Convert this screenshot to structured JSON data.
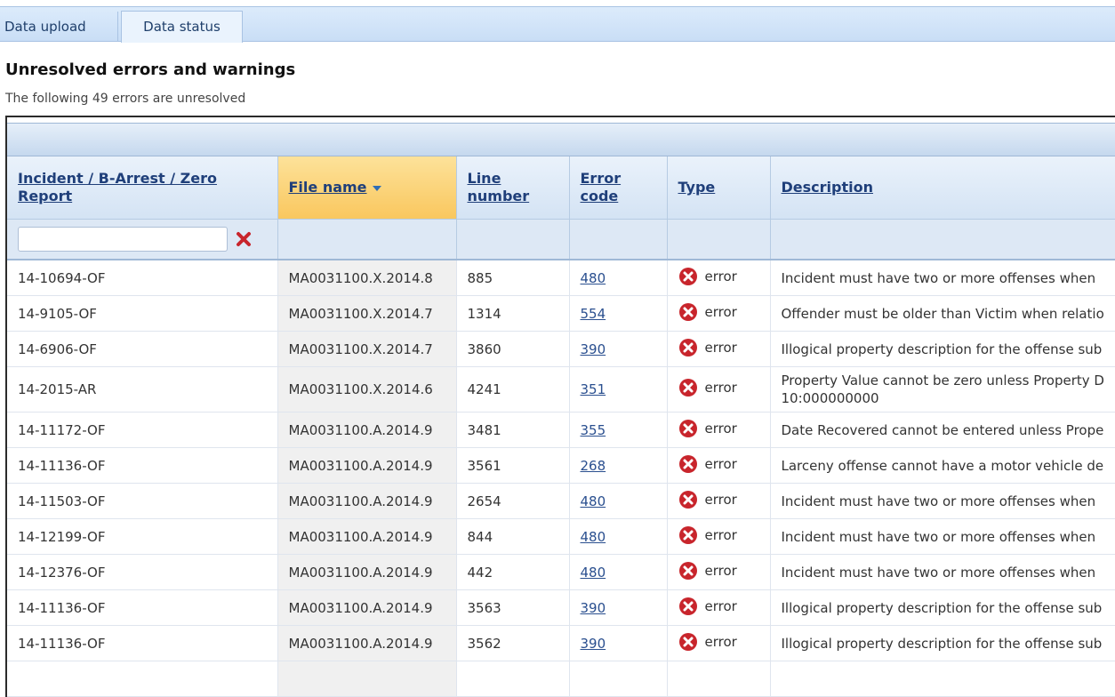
{
  "tabs": [
    {
      "label": "Data upload",
      "active": false
    },
    {
      "label": "Data status",
      "active": true
    }
  ],
  "page": {
    "title": "Unresolved errors and warnings",
    "subtitle": "The following 49 errors are unresolved"
  },
  "table": {
    "columns": [
      "Incident / B-Arrest / Zero Report",
      "File name",
      "Line number",
      "Error code",
      "Type",
      "Description"
    ],
    "sorted_column": "File name",
    "sort_direction": "descending",
    "filter": {
      "value": "",
      "clear_icon": "red-x-icon"
    },
    "rows": [
      {
        "incident": "14-10694-OF",
        "file": "MA0031100.X.2014.8",
        "line": "885",
        "code": "480",
        "type": "error",
        "description": "Incident must have two or more offenses when"
      },
      {
        "incident": "14-9105-OF",
        "file": "MA0031100.X.2014.7",
        "line": "1314",
        "code": "554",
        "type": "error",
        "description": "Offender must be older than Victim when relatio"
      },
      {
        "incident": "14-6906-OF",
        "file": "MA0031100.X.2014.7",
        "line": "3860",
        "code": "390",
        "type": "error",
        "description": "Illogical property description for the offense sub"
      },
      {
        "incident": "14-2015-AR",
        "file": "MA0031100.X.2014.6",
        "line": "4241",
        "code": "351",
        "type": "error",
        "description": "Property Value cannot be zero unless Property D 10:000000000"
      },
      {
        "incident": "14-11172-OF",
        "file": "MA0031100.A.2014.9",
        "line": "3481",
        "code": "355",
        "type": "error",
        "description": "Date Recovered cannot be entered unless Prope"
      },
      {
        "incident": "14-11136-OF",
        "file": "MA0031100.A.2014.9",
        "line": "3561",
        "code": "268",
        "type": "error",
        "description": "Larceny offense cannot have a motor vehicle de"
      },
      {
        "incident": "14-11503-OF",
        "file": "MA0031100.A.2014.9",
        "line": "2654",
        "code": "480",
        "type": "error",
        "description": "Incident must have two or more offenses when"
      },
      {
        "incident": "14-12199-OF",
        "file": "MA0031100.A.2014.9",
        "line": "844",
        "code": "480",
        "type": "error",
        "description": "Incident must have two or more offenses when"
      },
      {
        "incident": "14-12376-OF",
        "file": "MA0031100.A.2014.9",
        "line": "442",
        "code": "480",
        "type": "error",
        "description": "Incident must have two or more offenses when"
      },
      {
        "incident": "14-11136-OF",
        "file": "MA0031100.A.2014.9",
        "line": "3563",
        "code": "390",
        "type": "error",
        "description": "Illogical property description for the offense sub"
      },
      {
        "incident": "14-11136-OF",
        "file": "MA0031100.A.2014.9",
        "line": "3562",
        "code": "390",
        "type": "error",
        "description": "Illogical property description for the offense sub"
      },
      {
        "incident": "",
        "file": "",
        "line": "",
        "code": "",
        "type": "",
        "description": ""
      }
    ]
  },
  "icons": {
    "error": "error-circle-x-icon",
    "sort": "sort-down-arrow-icon"
  },
  "colors": {
    "tab_bar": "#c9def6",
    "sorted_header": "#f9c75e",
    "link": "#2a4f8f",
    "error_icon": "#c8252c"
  }
}
